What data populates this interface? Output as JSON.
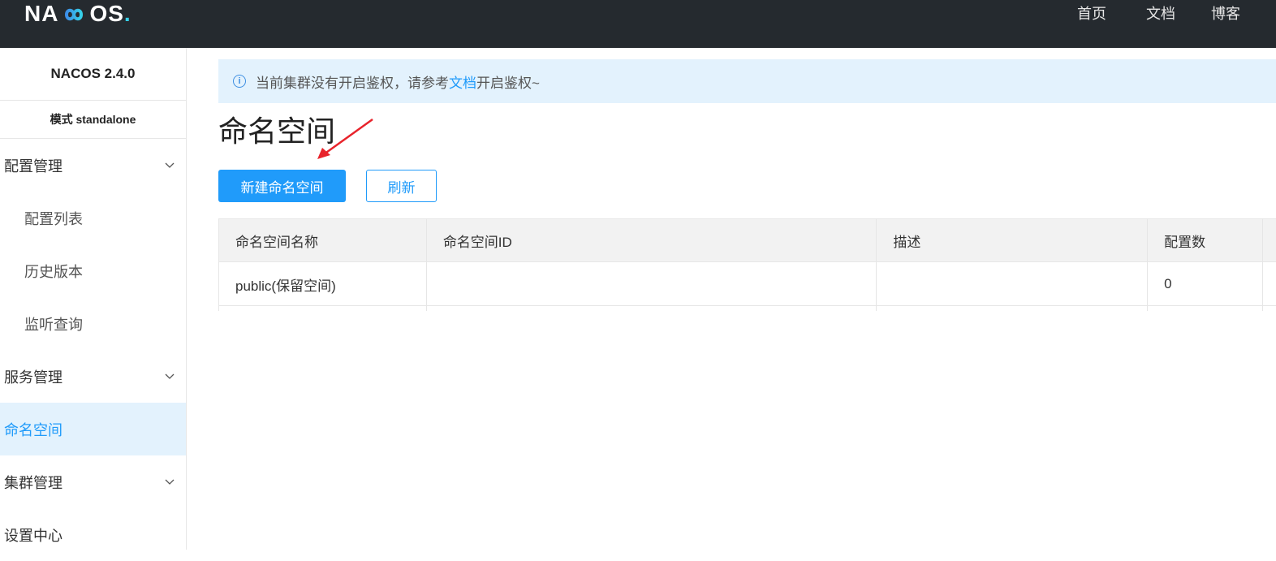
{
  "header": {
    "logo_left": "NA",
    "logo_right": "OS",
    "logo_dot": ".",
    "nav": [
      "首页",
      "文档",
      "博客"
    ]
  },
  "sidebar": {
    "version": "NACOS 2.4.0",
    "mode": "模式 standalone",
    "items": [
      {
        "label": "配置管理",
        "expandable": true
      },
      {
        "label": "配置列表"
      },
      {
        "label": "历史版本"
      },
      {
        "label": "监听查询"
      },
      {
        "label": "服务管理",
        "expandable": true
      },
      {
        "label": "命名空间",
        "active": true
      },
      {
        "label": "集群管理",
        "expandable": true
      },
      {
        "label": "设置中心"
      }
    ]
  },
  "notice": {
    "before": "当前集群没有开启鉴权，请参考",
    "link": "文档",
    "after": "开启鉴权~"
  },
  "page": {
    "title": "命名空间",
    "new_button": "新建命名空间",
    "refresh_button": "刷新"
  },
  "table": {
    "columns": [
      "命名空间名称",
      "命名空间ID",
      "描述",
      "配置数"
    ],
    "rows": [
      [
        "public(保留空间)",
        "",
        "",
        "0"
      ]
    ]
  },
  "colors": {
    "primary": "#209bfa",
    "topbar": "#252a2f",
    "active_bg": "#e3f2fd",
    "arrow": "#e8232b"
  }
}
